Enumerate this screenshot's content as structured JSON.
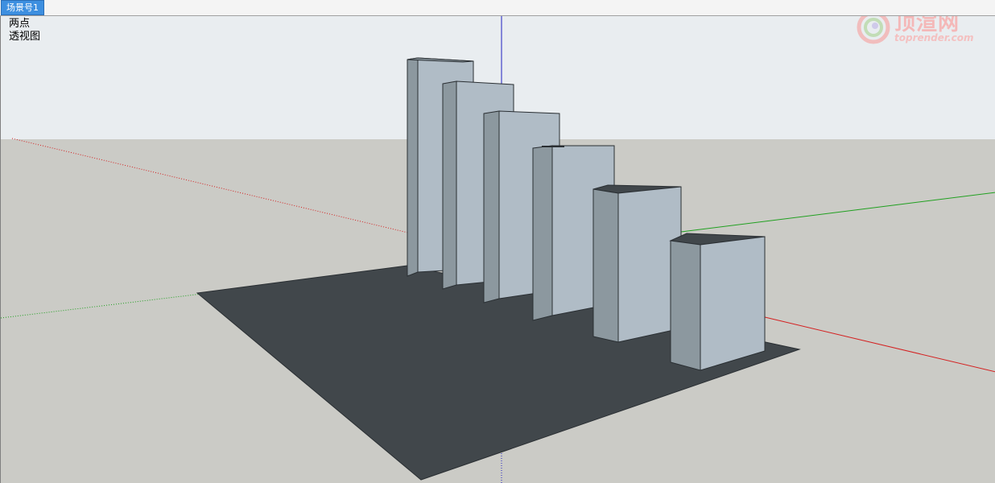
{
  "scene_tabs": [
    {
      "label": "场景号1",
      "active": true
    }
  ],
  "viewport": {
    "camera_mode_line1": "两点",
    "camera_mode_line2": "透视图",
    "sky_color": "#e9edf0",
    "ground_color": "#cbcbc6",
    "shadow_color": "#41474b",
    "box_front_color": "#b0bcc6",
    "box_side_color": "#8c989f",
    "axis_red": "#d42020",
    "axis_green": "#20a020",
    "axis_blue": "#2020c0"
  },
  "watermark": {
    "name": "顶渲网",
    "url": "toprender.com",
    "logo_icon": "swirl-logo-icon"
  },
  "model": {
    "object_count": 6,
    "object_type": "rectangular-block"
  }
}
